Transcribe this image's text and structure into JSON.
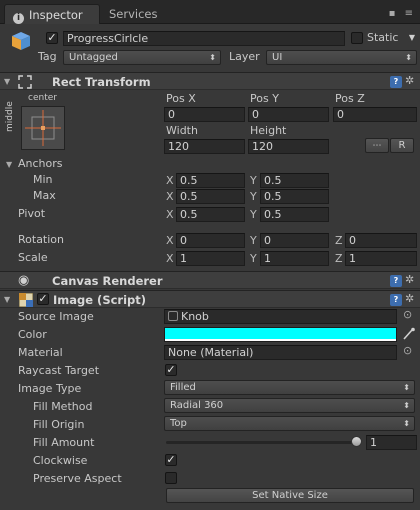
{
  "tabs": {
    "inspector": "Inspector",
    "services": "Services"
  },
  "object": {
    "name": "ProgressCirlcle",
    "active": true,
    "static_label": "Static",
    "static": false,
    "tag_label": "Tag",
    "tag_value": "Untagged",
    "layer_label": "Layer",
    "layer_value": "UI"
  },
  "rect_transform": {
    "title": "Rect Transform",
    "anchor_h": "center",
    "anchor_v": "middle",
    "headers": {
      "pos_x": "Pos X",
      "pos_y": "Pos Y",
      "pos_z": "Pos Z",
      "width": "Width",
      "height": "Height"
    },
    "pos_x": "0",
    "pos_y": "0",
    "pos_z": "0",
    "width": "120",
    "height": "120",
    "raw_label": "R",
    "anchors_label": "Anchors",
    "min_label": "Min",
    "min_x": "0.5",
    "min_y": "0.5",
    "max_label": "Max",
    "max_x": "0.5",
    "max_y": "0.5",
    "pivot_label": "Pivot",
    "pivot_x": "0.5",
    "pivot_y": "0.5",
    "rotation_label": "Rotation",
    "rot_x": "0",
    "rot_y": "0",
    "rot_z": "0",
    "scale_label": "Scale",
    "scale_x": "1",
    "scale_y": "1",
    "scale_z": "1",
    "axis_x": "X",
    "axis_y": "Y",
    "axis_z": "Z"
  },
  "canvas_renderer": {
    "title": "Canvas Renderer"
  },
  "image": {
    "title": "Image (Script)",
    "enabled": true,
    "source_image_label": "Source Image",
    "source_image": "Knob",
    "color_label": "Color",
    "color": "#00ffff",
    "material_label": "Material",
    "material": "None (Material)",
    "raycast_label": "Raycast Target",
    "raycast": true,
    "image_type_label": "Image Type",
    "image_type": "Filled",
    "fill_method_label": "Fill Method",
    "fill_method": "Radial 360",
    "fill_origin_label": "Fill Origin",
    "fill_origin": "Top",
    "fill_amount_label": "Fill Amount",
    "fill_amount": "1",
    "clockwise_label": "Clockwise",
    "clockwise": true,
    "preserve_label": "Preserve Aspect",
    "preserve": false,
    "native_size_label": "Set Native Size"
  },
  "glyphs": {
    "check": "✓",
    "dropdown_arrow": "⬍",
    "fold_open": "▼",
    "eye": "◉",
    "gear": "✲",
    "help": "?",
    "target": "⊙"
  }
}
